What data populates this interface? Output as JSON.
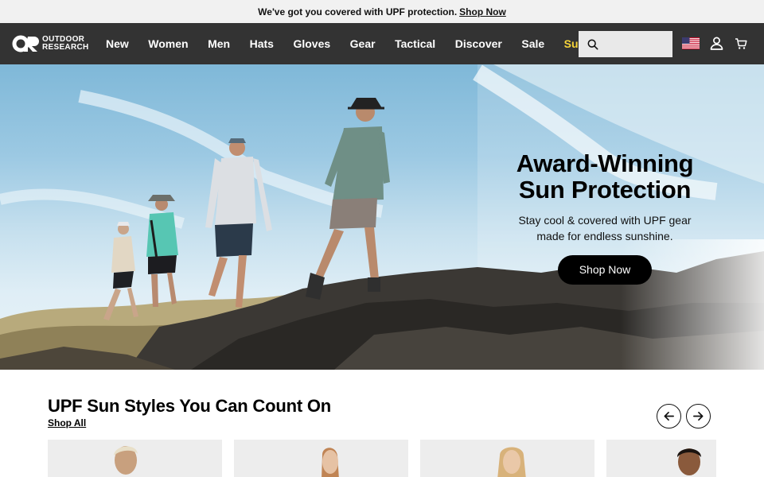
{
  "announcement": {
    "text": "We've got you covered with UPF protection.",
    "link": "Shop Now"
  },
  "header": {
    "logo": {
      "wordmark_line1": "OUTDOOR",
      "wordmark_line2": "RESEARCH"
    },
    "nav": [
      "New",
      "Women",
      "Men",
      "Hats",
      "Gloves",
      "Gear",
      "Tactical",
      "Discover",
      "Sale",
      "Sun"
    ],
    "search": {
      "placeholder": "",
      "icon": "search-icon"
    },
    "icons": {
      "flag": "us-flag-icon",
      "account": "account-icon",
      "cart": "cart-icon"
    },
    "colors": {
      "bar": "#333333",
      "highlight": "#f6d43a"
    }
  },
  "hero": {
    "title_line1": "Award-Winning",
    "title_line2": "Sun Protection",
    "subtitle_line1": "Stay cool & covered with UPF gear",
    "subtitle_line2": "made for endless sunshine.",
    "cta": "Shop Now"
  },
  "section": {
    "title": "UPF Sun Styles You Can Count On",
    "link": "Shop All",
    "prev_icon": "arrow-left-icon",
    "next_icon": "arrow-right-icon"
  },
  "products": [
    {
      "image": "product-image-man-blond"
    },
    {
      "image": "product-image-woman-red-hair"
    },
    {
      "image": "product-image-woman-blond"
    },
    {
      "image": "product-image-man-dark-hair"
    }
  ]
}
